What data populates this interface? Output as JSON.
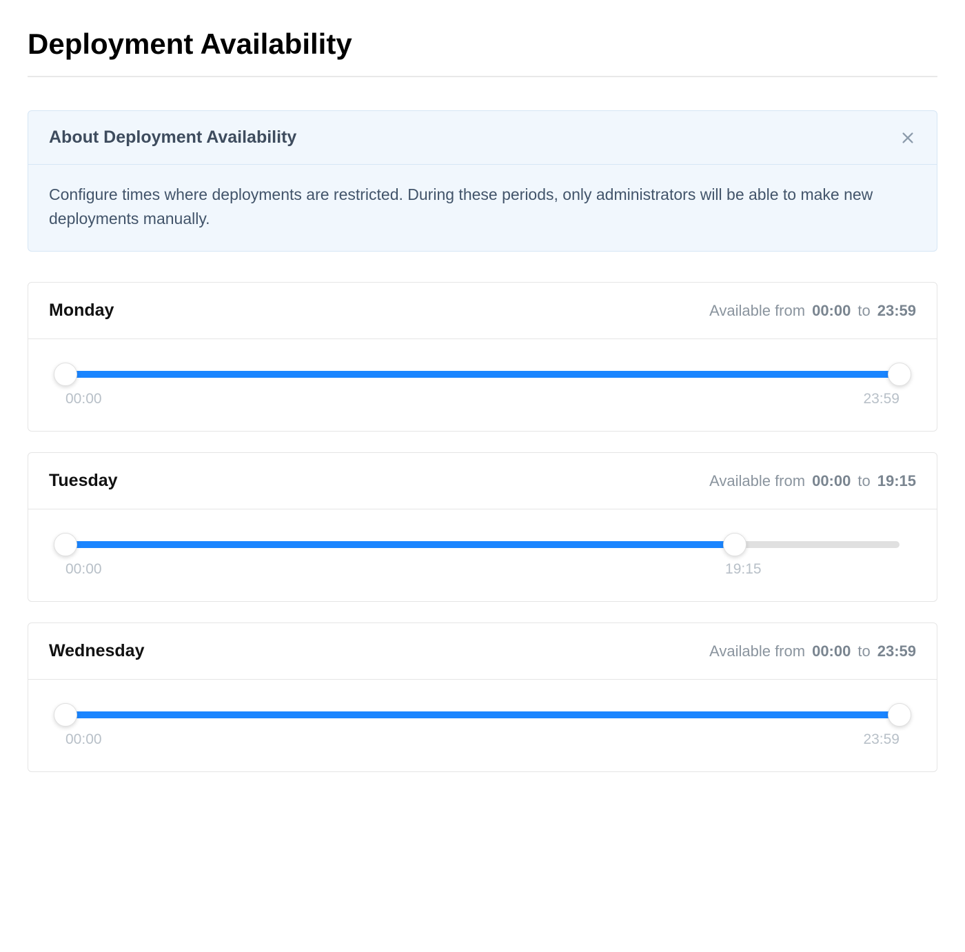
{
  "page": {
    "title": "Deployment Availability"
  },
  "banner": {
    "title": "About Deployment Availability",
    "body": "Configure times where deployments are restricted. During these periods, only administrators will be able to make new deployments manually."
  },
  "labels": {
    "available_from": "Available from",
    "to": "to"
  },
  "slider": {
    "track_max_minutes": 1439
  },
  "days": [
    {
      "name": "Monday",
      "from": "00:00",
      "to": "23:59",
      "from_minutes": 0,
      "to_minutes": 1439
    },
    {
      "name": "Tuesday",
      "from": "00:00",
      "to": "19:15",
      "from_minutes": 0,
      "to_minutes": 1155
    },
    {
      "name": "Wednesday",
      "from": "00:00",
      "to": "23:59",
      "from_minutes": 0,
      "to_minutes": 1439
    }
  ]
}
